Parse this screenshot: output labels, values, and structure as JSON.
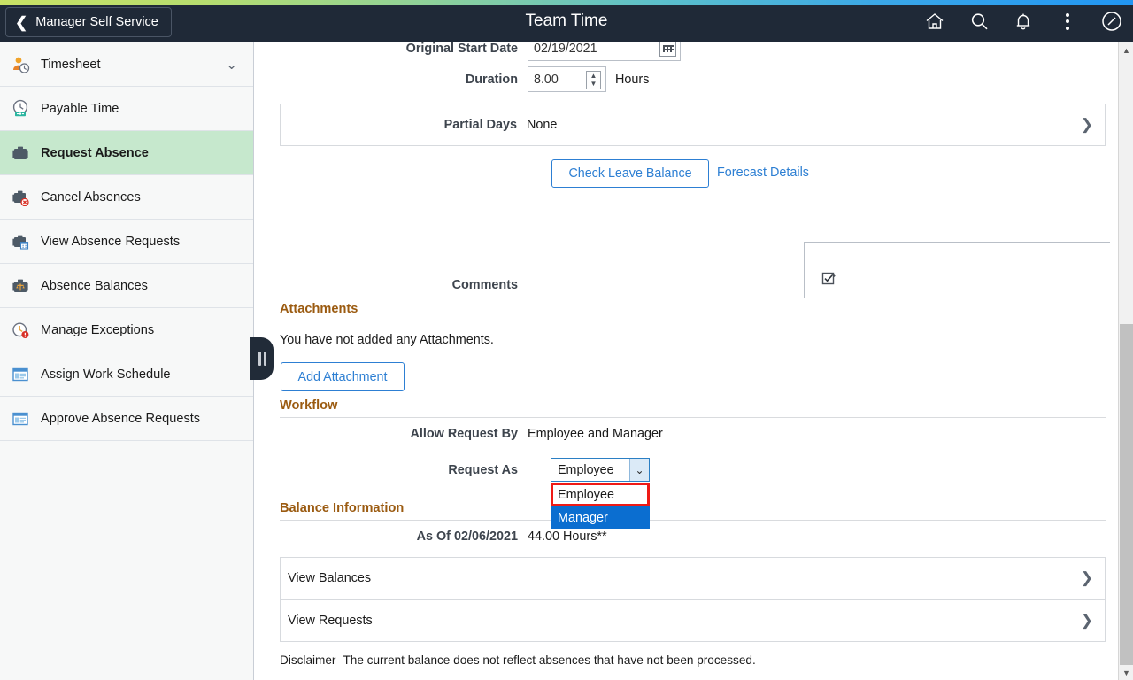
{
  "header": {
    "back_label": "Manager Self Service",
    "back_icon": "chevron-left-icon",
    "title": "Team Time",
    "icons": [
      {
        "name": "home-icon",
        "label": "Home"
      },
      {
        "name": "search-icon",
        "label": "Search"
      },
      {
        "name": "notifications-bell-icon",
        "label": "Notifications"
      },
      {
        "name": "actions-kebab-icon",
        "label": "Actions"
      },
      {
        "name": "navbar-compass-icon",
        "label": "NavBar"
      }
    ],
    "bar_color": "#1f2937",
    "gradient_from": "#c9e265",
    "gradient_to": "#2196f3"
  },
  "sidebar": {
    "selected_bg": "#c6e8cd",
    "items": [
      {
        "label": "Timesheet",
        "icon": "timesheet-person-clock-icon",
        "selected": false,
        "chevron": "chevron-down-icon"
      },
      {
        "label": "Payable Time",
        "icon": "payable-time-clock-icon",
        "selected": false
      },
      {
        "label": "Request Absence",
        "icon": "briefcase-icon",
        "selected": true
      },
      {
        "label": "Cancel Absences",
        "icon": "briefcase-cancel-icon",
        "selected": false
      },
      {
        "label": "View Absence Requests",
        "icon": "briefcase-calendar-icon",
        "selected": false
      },
      {
        "label": "Absence Balances",
        "icon": "briefcase-scale-icon",
        "selected": false
      },
      {
        "label": "Manage Exceptions",
        "icon": "clock-alert-icon",
        "selected": false
      },
      {
        "label": "Assign Work Schedule",
        "icon": "window-schedule-icon",
        "selected": false
      },
      {
        "label": "Approve Absence Requests",
        "icon": "window-approve-icon",
        "selected": false
      }
    ],
    "collapse_handle": "sidebar-collapse-handle"
  },
  "form": {
    "original_start_date": {
      "label": "Original Start Date",
      "value": "02/19/2021",
      "calendar_icon": "calendar-icon"
    },
    "duration": {
      "label": "Duration",
      "value": "8.00",
      "unit": "Hours",
      "spinner_icon": "spinner-up-down-icon"
    },
    "partial_days": {
      "label": "Partial Days",
      "value": "None",
      "chevron": "chevron-right-icon"
    },
    "check_leave_balance_label": "Check Leave Balance",
    "forecast_details_label": "Forecast Details",
    "comments": {
      "label": "Comments",
      "value": "",
      "placeholder": ""
    },
    "spellcheck_icon": "spellcheck-icon"
  },
  "attachments": {
    "heading": "Attachments",
    "empty_text": "You have not added any Attachments.",
    "add_button_label": "Add Attachment"
  },
  "workflow": {
    "heading": "Workflow",
    "allow_request_by": {
      "label": "Allow Request By",
      "value": "Employee and Manager"
    },
    "request_as": {
      "label": "Request As",
      "selected": "Employee",
      "open": true,
      "arrow_icon": "chevron-down-icon",
      "options": [
        {
          "label": "Employee",
          "state": "focused"
        },
        {
          "label": "Manager",
          "state": "highlighted"
        }
      ],
      "focus_outline_color": "#ef1a16",
      "highlight_color": "#0b6ed0"
    }
  },
  "balance": {
    "heading": "Balance Information",
    "as_of": {
      "label": "As Of 02/06/2021",
      "value": "44.00 Hours**"
    },
    "rows": [
      {
        "label": "View Balances",
        "chevron": "chevron-right-icon"
      },
      {
        "label": "View Requests",
        "chevron": "chevron-right-icon"
      }
    ],
    "disclaimer_label": "Disclaimer",
    "disclaimer_text": "The current balance does not reflect absences that have not been processed."
  },
  "scrollbar": {
    "up_icon": "chevron-up-icon",
    "down_icon": "chevron-down-icon"
  }
}
